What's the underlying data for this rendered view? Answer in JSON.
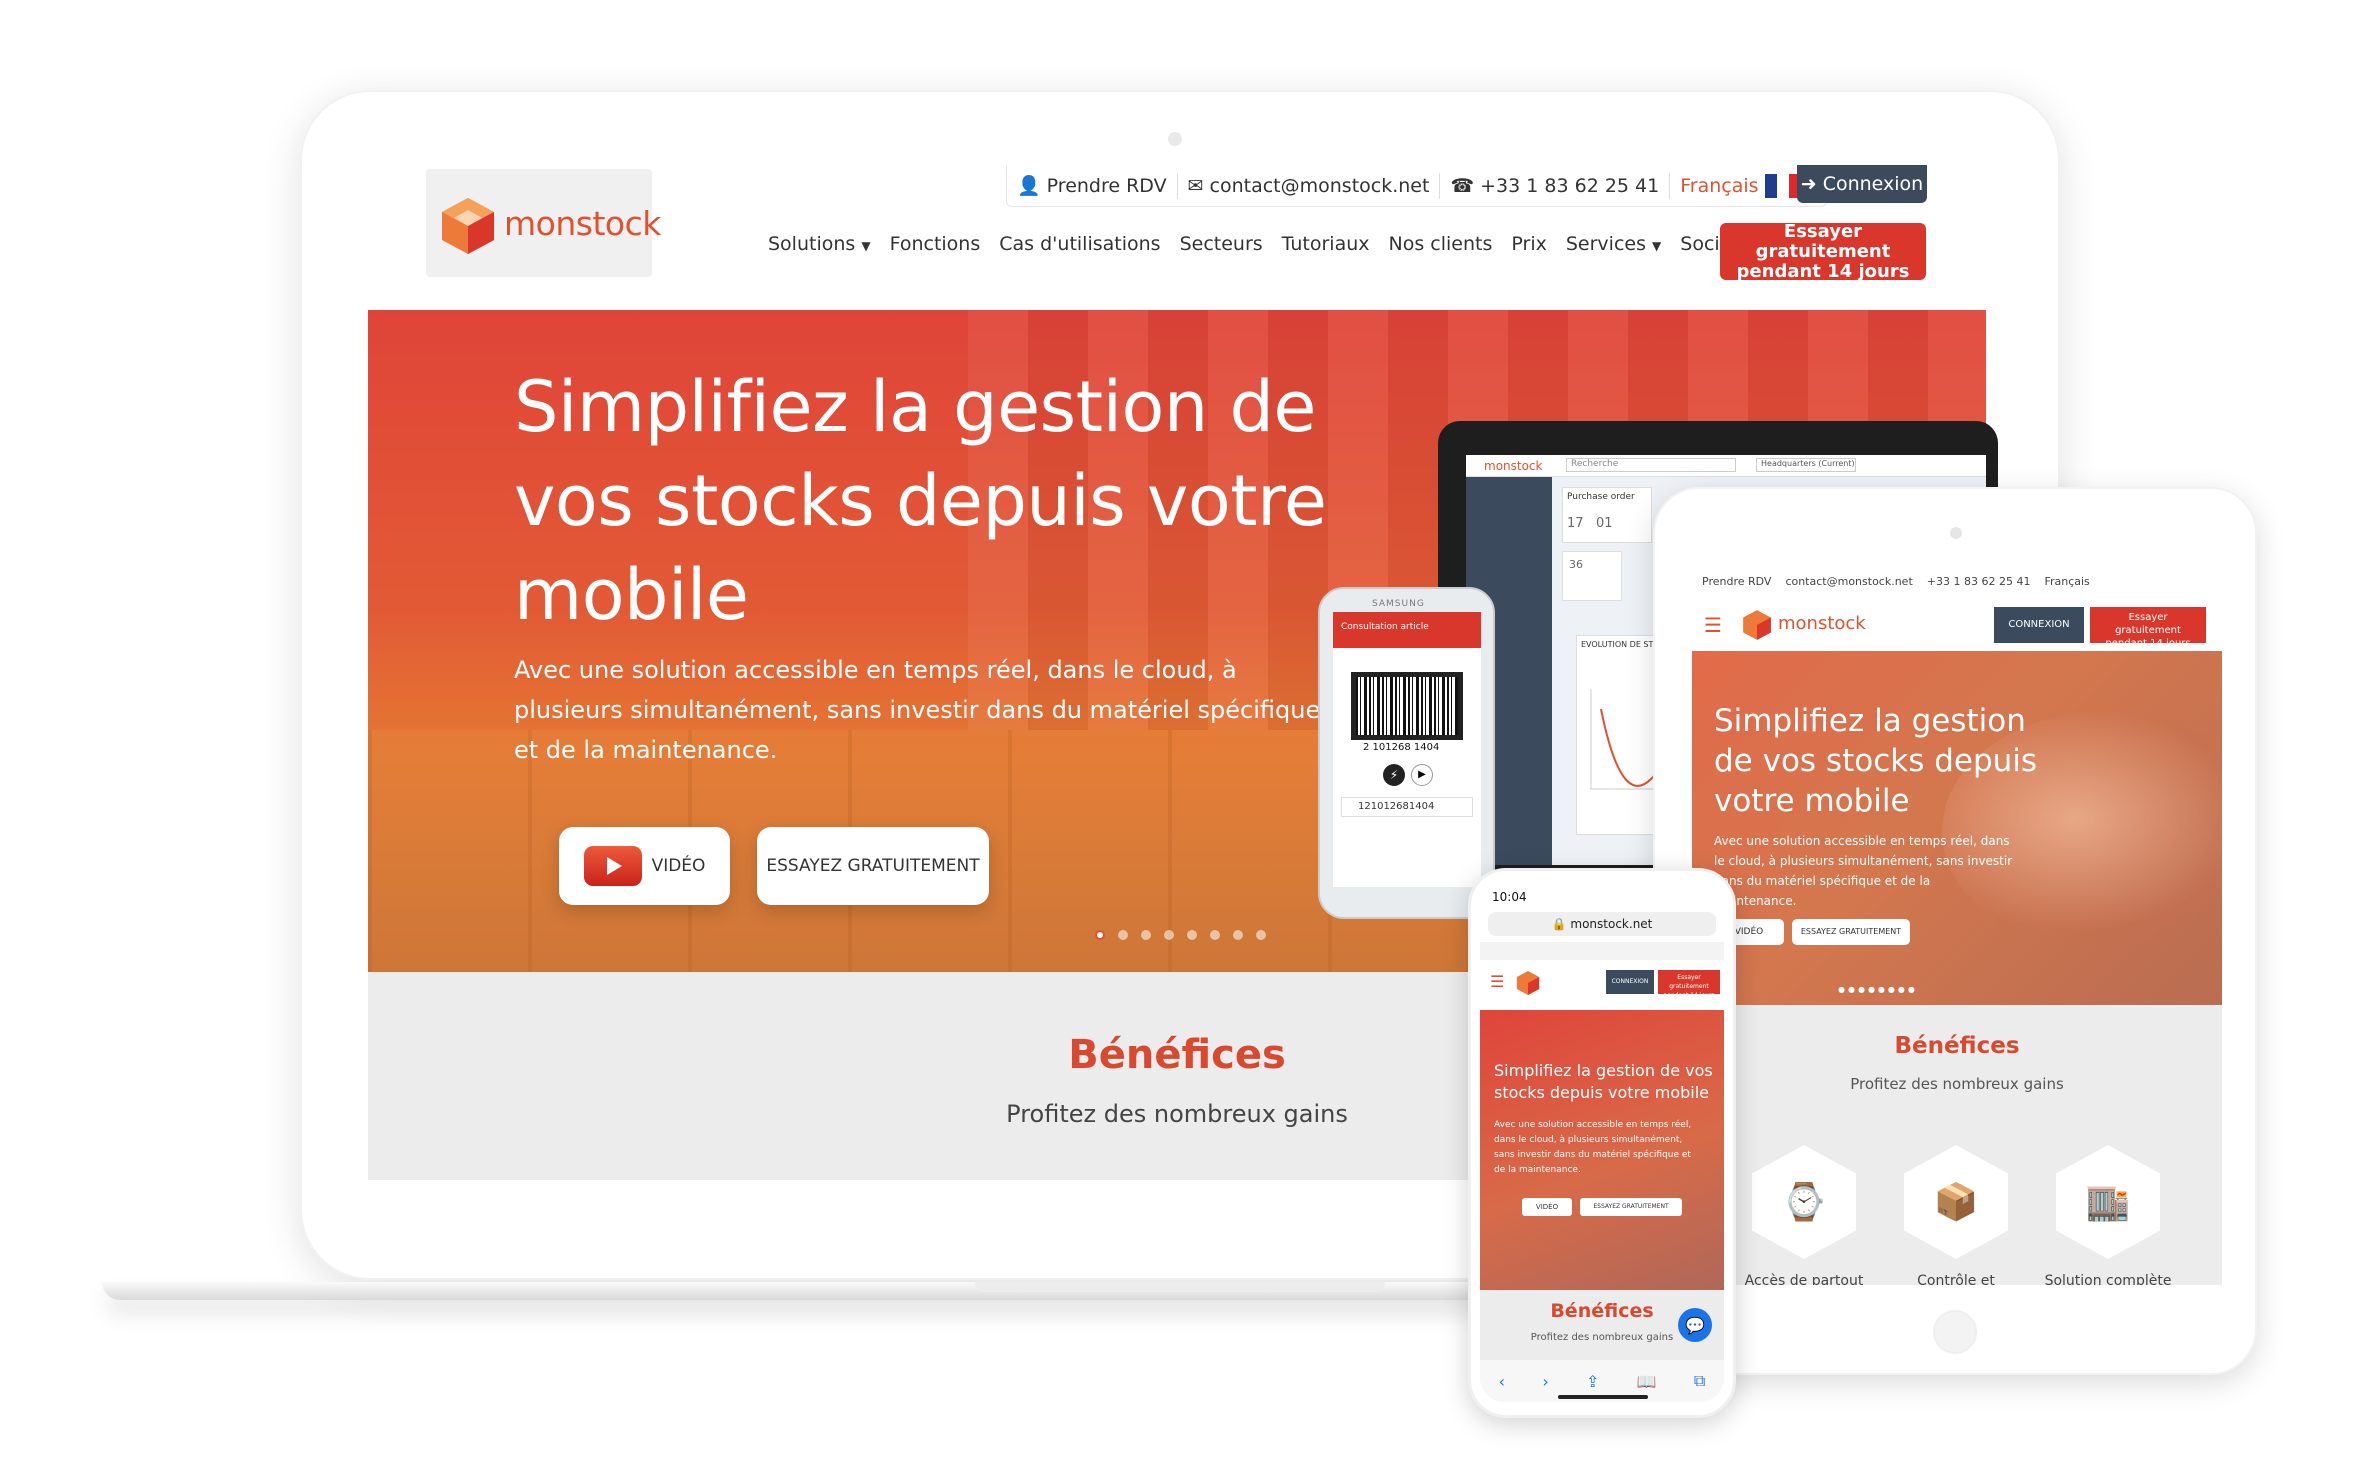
{
  "desktop": {
    "logo_text": "monstock",
    "topbar": {
      "rdv": "Prendre RDV",
      "email": "contact@monstock.net",
      "phone": "+33 1 83 62 25 41",
      "language": "Français"
    },
    "connexion_label": "Connexion",
    "nav": [
      "Solutions",
      "Fonctions",
      "Cas d'utilisations",
      "Secteurs",
      "Tutoriaux",
      "Nos clients",
      "Prix",
      "Services",
      "Société"
    ],
    "trial_button": "Essayer gratuitement pendant 14 jours",
    "hero": {
      "title": "Simplifiez la gestion de vos stocks depuis votre mobile",
      "text": "Avec une solution accessible en temps réel, dans le cloud, à plusieurs simultanément, sans investir dans du matériel spécifique et de la maintenance.",
      "video_button": "VIDÉO",
      "trial_button": "ESSAYEZ GRATUITEMENT",
      "slide_count": 8,
      "active_slide": 1
    },
    "benefits": {
      "title": "Bénéfices",
      "subtitle": "Profitez des nombreux gains"
    }
  },
  "mini_laptop": {
    "logo": "monstock",
    "search": "Recherche",
    "location": "Headquarters (Current)",
    "card_title": "Purchase order",
    "kpi_values": [
      "17",
      "01",
      "36"
    ],
    "chart_title": "EVOLUTION DE STOCK"
  },
  "samsung": {
    "brand": "SAMSUNG",
    "header": "Consultation article",
    "barcode_number": "2 101268 1404",
    "field_value": "121012681404"
  },
  "tablet": {
    "topbar": {
      "rdv": "Prendre RDV",
      "email": "contact@monstock.net",
      "phone": "+33 1 83 62 25 41",
      "language": "Français"
    },
    "logo_text": "monstock",
    "connexion_label": "CONNEXION",
    "trial_button": "Essayer gratuitement pendant 14 jours",
    "hero_title": "Simplifiez la gestion de vos stocks depuis votre mobile",
    "hero_text": "Avec une solution accessible en temps réel, dans le cloud, à plusieurs simultanément, sans investir dans du matériel spécifique et de la maintenance.",
    "video_button": "VIDÉO",
    "trial_button_hero": "ESSAYEZ GRATUITEMENT",
    "benefits_title": "Bénéfices",
    "benefits_subtitle": "Profitez des nombreux gains",
    "features": [
      "Accès de partout",
      "Contrôle et",
      "Solution complète"
    ]
  },
  "iphone": {
    "time": "10:04",
    "url": "monstock.net",
    "connexion_label": "CONNEXION",
    "trial_button": "Essayer gratuitement pendant 14 jours",
    "hero_title": "Simplifiez la gestion de vos stocks depuis votre mobile",
    "hero_text": "Avec une solution accessible en temps réel, dans le cloud, à plusieurs simultanément, sans investir dans du matériel spécifique et de la maintenance.",
    "video_button": "VIDÉO",
    "trial_button_hero": "ESSAYEZ GRATUITEMENT",
    "benefits_title": "Bénéfices",
    "benefits_subtitle": "Profitez des nombreux gains"
  },
  "colors": {
    "brand": "#e0522f",
    "accent_red": "#d9372b",
    "dark": "#3c4a5e"
  }
}
